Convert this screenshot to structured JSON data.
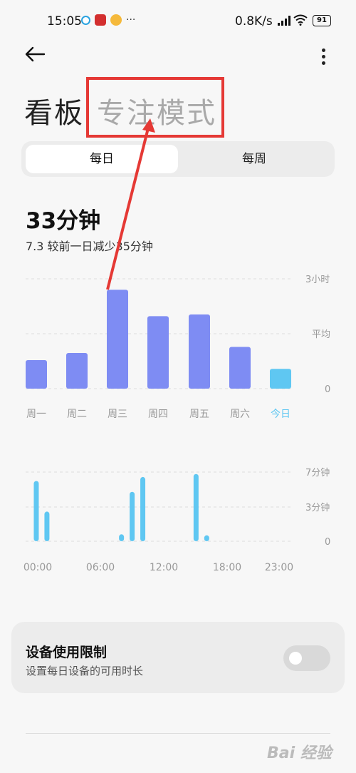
{
  "status_bar": {
    "time": "15:05",
    "network_speed": "0.8K/s",
    "battery": "91"
  },
  "header": {
    "back_icon": "arrow-left-icon",
    "more_icon": "more-vert-icon"
  },
  "tabs": [
    {
      "label": "看板",
      "active": true
    },
    {
      "label": "专注模式",
      "active": false
    }
  ],
  "segmented": {
    "daily": "每日",
    "weekly": "每周",
    "selected": "daily"
  },
  "summary": {
    "total": "33分钟",
    "compare": "7.3  较前一日减少35分钟"
  },
  "colors": {
    "bar": "#7e8cf3",
    "today_bar": "#5fc7f2",
    "highlight": "#e53935"
  },
  "chart_data": [
    {
      "type": "bar",
      "categories": [
        "周一",
        "周二",
        "周三",
        "周四",
        "周五",
        "周六",
        "今日"
      ],
      "values": [
        0.52,
        0.65,
        1.8,
        1.32,
        1.35,
        0.76,
        0.36
      ],
      "highlight_category": "今日",
      "y_tick_labels": [
        "3小时",
        "平均",
        "0"
      ],
      "ylim": [
        0,
        2
      ],
      "grid": true
    },
    {
      "type": "bar",
      "x_tick_labels": [
        "00:00",
        "06:00",
        "12:00",
        "18:00",
        "23:00"
      ],
      "x": [
        1,
        2,
        9,
        10,
        11,
        16,
        17
      ],
      "values": [
        6.1,
        3.0,
        0.7,
        5.0,
        6.5,
        6.8,
        0.6
      ],
      "xlim": [
        0,
        25
      ],
      "y_tick_labels": [
        "7分钟",
        "3分钟",
        "0"
      ],
      "ylim": [
        0,
        7
      ],
      "grid": true
    }
  ],
  "device_limit": {
    "title": "设备使用限制",
    "subtitle": "设置每日设备的可用时长",
    "enabled": false
  },
  "watermark": "Bai 经验"
}
